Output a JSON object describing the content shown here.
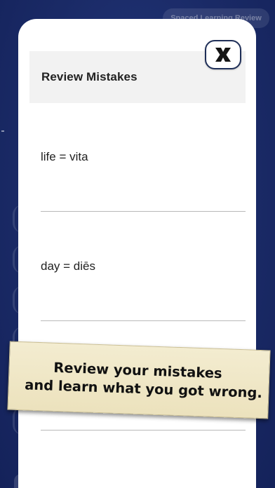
{
  "background": {
    "top_button_label": "Spaced Learning Review"
  },
  "modal": {
    "title": "Review Mistakes",
    "close_icon": "close-x-icon",
    "items": [
      {
        "text": "life = vita"
      },
      {
        "text": "day = diēs"
      },
      {
        "text": ""
      }
    ]
  },
  "banner": {
    "line1": "Review your mistakes",
    "line2": "and learn what you got wrong."
  },
  "colors": {
    "background": "#1d2f6e",
    "modal": "#ffffff",
    "header": "#f2f2f2",
    "close_border": "#1f2f58",
    "banner": "#f0e7c6"
  }
}
